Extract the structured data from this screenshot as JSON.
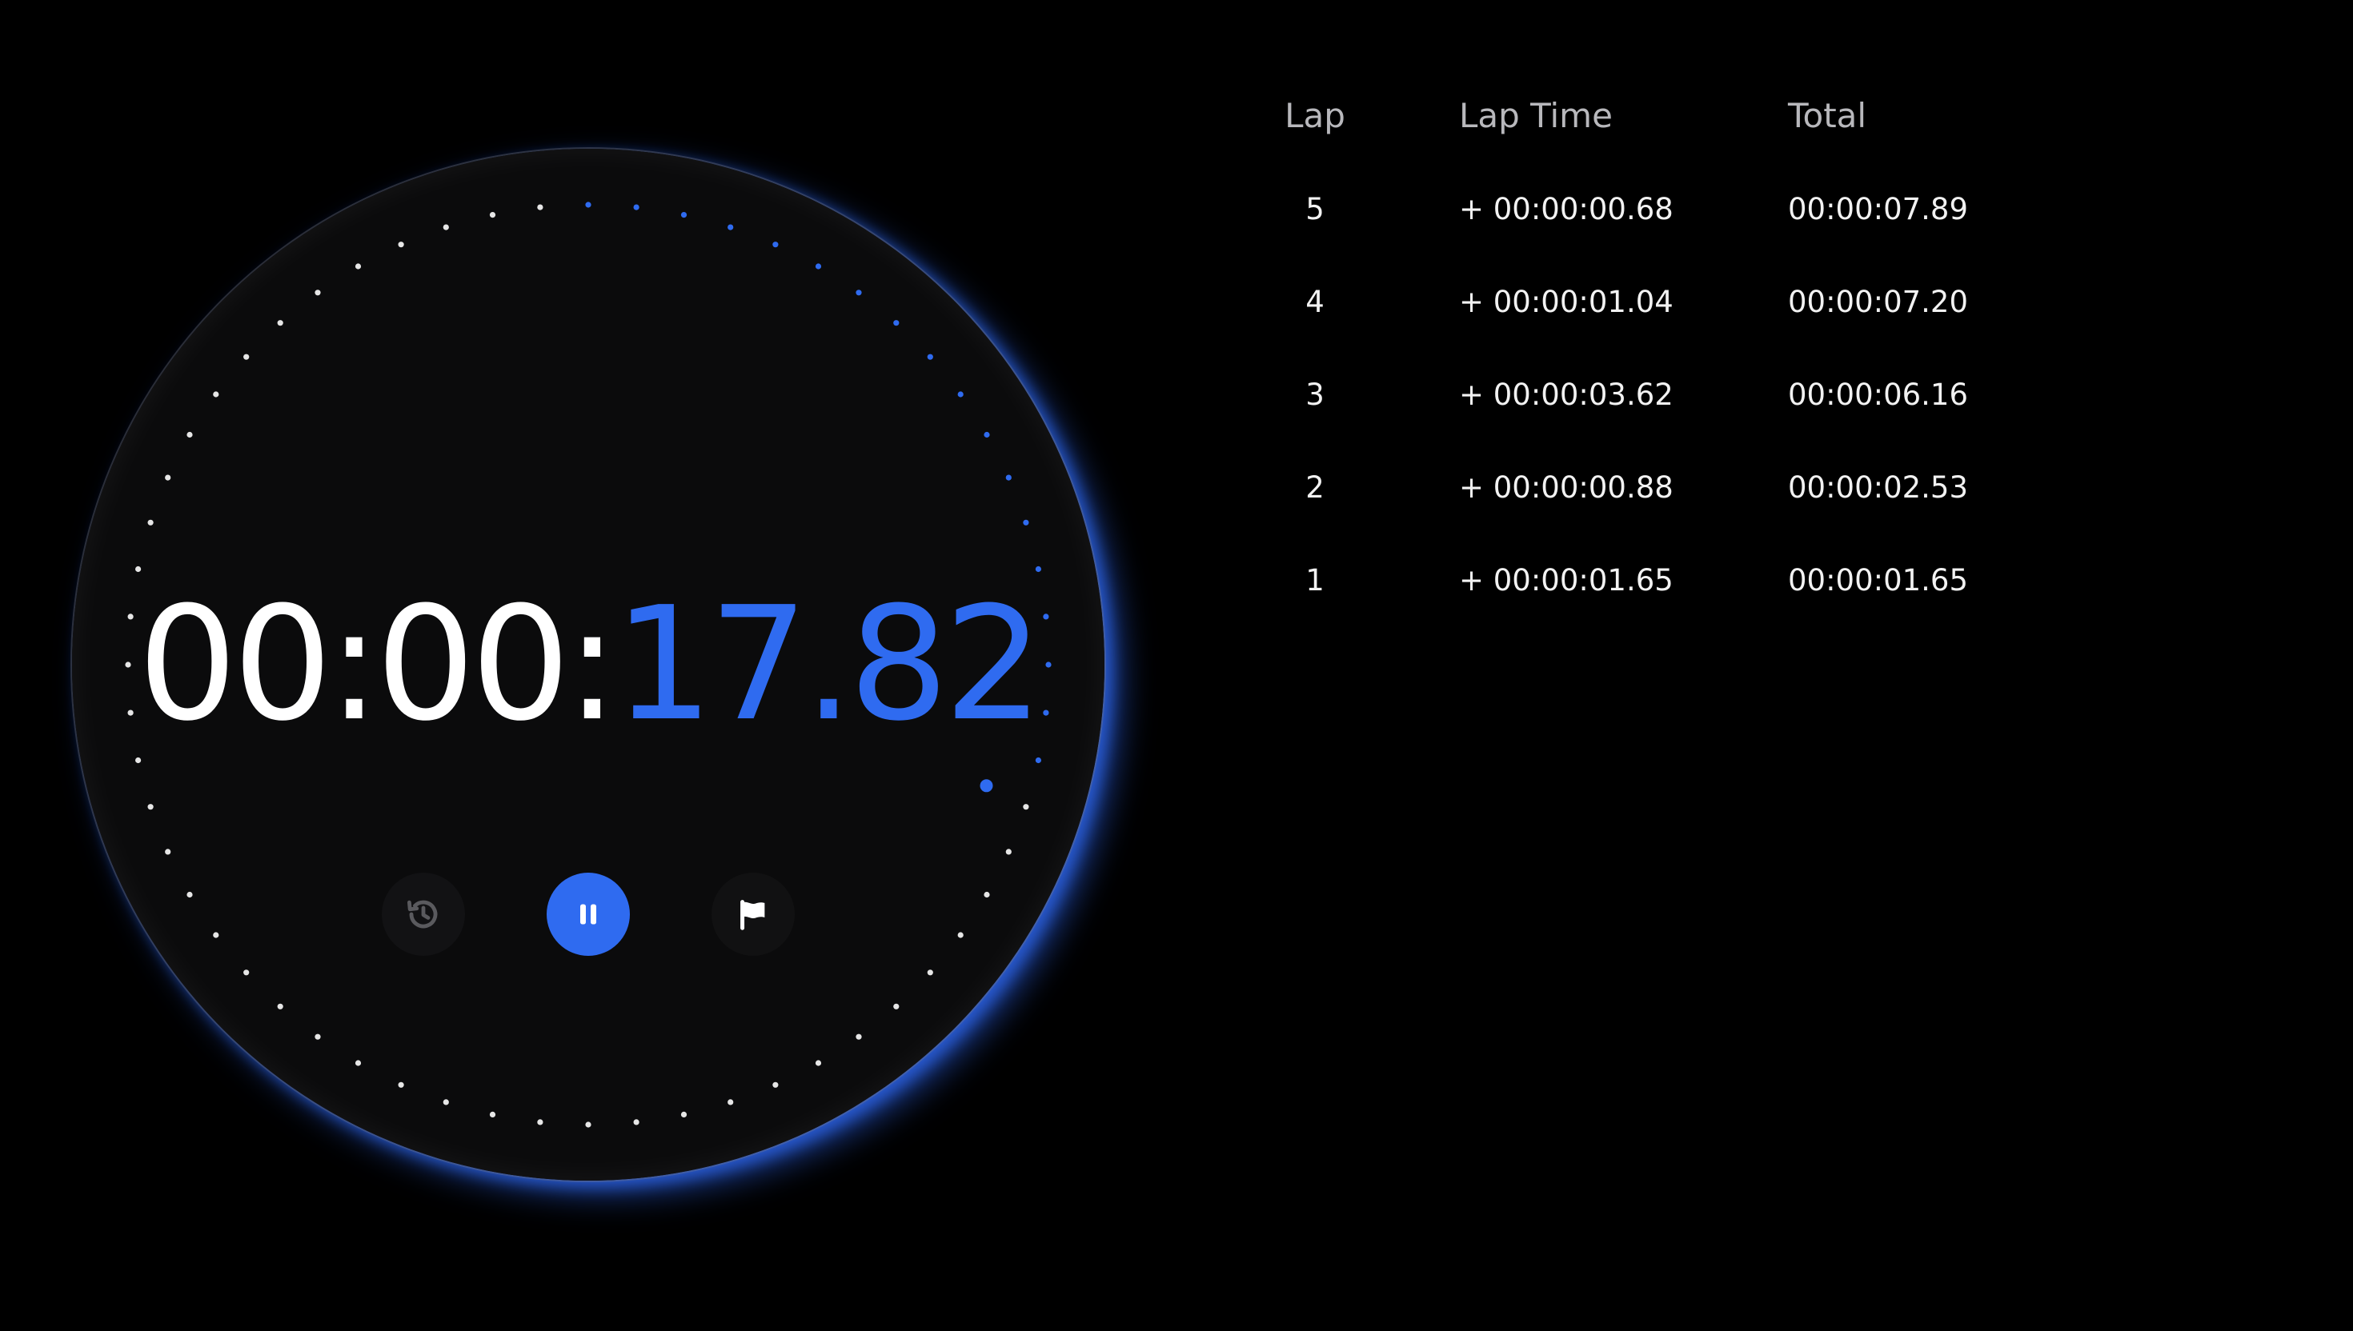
{
  "stopwatch": {
    "time_fixed": "00:00:",
    "time_running": "17.82",
    "progress_seconds": 17.82,
    "accent_color": "#2f6bf0",
    "tick_color": "#e6e6e6",
    "controls": {
      "reset_icon": "history-icon",
      "pause_icon": "pause-icon",
      "lap_icon": "flag-icon"
    }
  },
  "laps": {
    "headers": {
      "lap": "Lap",
      "lap_time": "Lap Time",
      "total": "Total"
    },
    "rows": [
      {
        "lap": "5",
        "lap_time": "+ 00:00:00.68",
        "total": "00:00:07.89"
      },
      {
        "lap": "4",
        "lap_time": "+ 00:00:01.04",
        "total": "00:00:07.20"
      },
      {
        "lap": "3",
        "lap_time": "+ 00:00:03.62",
        "total": "00:00:06.16"
      },
      {
        "lap": "2",
        "lap_time": "+ 00:00:00.88",
        "total": "00:00:02.53"
      },
      {
        "lap": "1",
        "lap_time": "+ 00:00:01.65",
        "total": "00:00:01.65"
      }
    ]
  }
}
